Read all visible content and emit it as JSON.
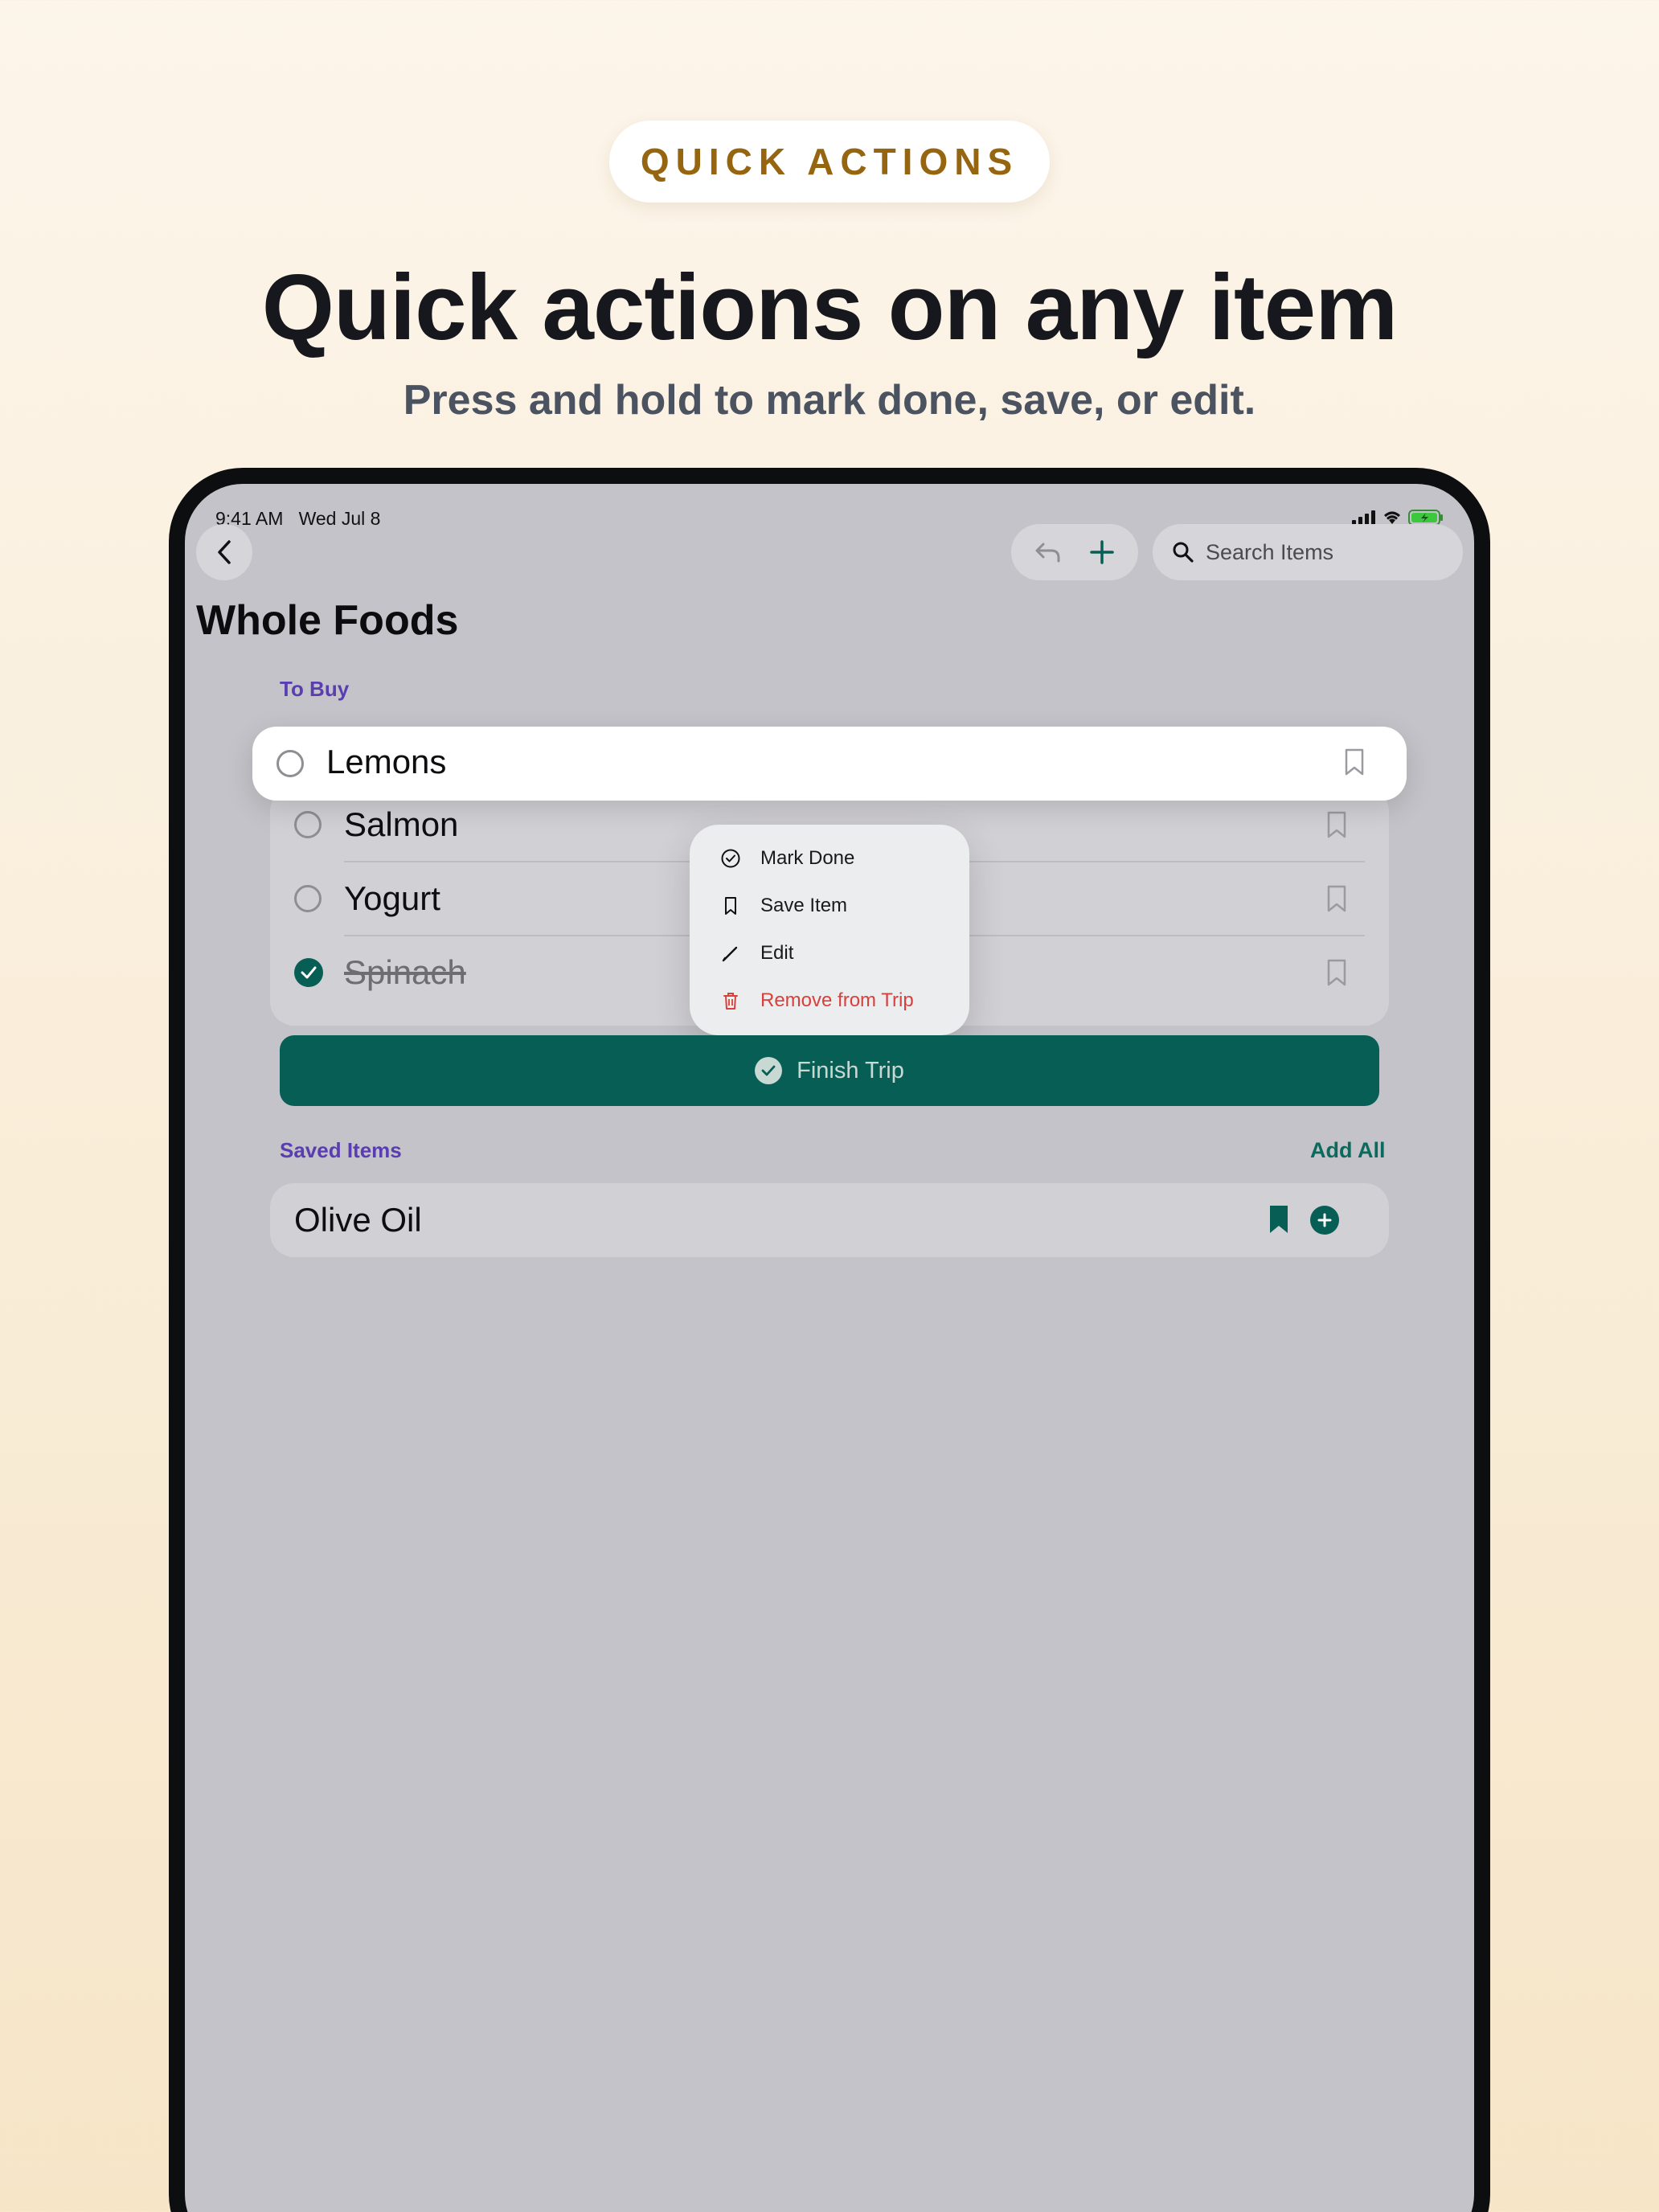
{
  "banner": {
    "pill": "QUICK ACTIONS",
    "headline": "Quick actions on any item",
    "subhead": "Press and hold to mark done, save, or edit."
  },
  "status_bar": {
    "time": "9:41 AM",
    "date": "Wed Jul 8"
  },
  "toolbar": {
    "back_icon": "chevron-left-icon",
    "undo_icon": "undo-icon",
    "add_icon": "plus-icon",
    "search_placeholder": "Search Items"
  },
  "page": {
    "title": "Whole Foods"
  },
  "to_buy": {
    "label": "To Buy",
    "items": [
      {
        "name": "Lemons",
        "done": false,
        "saved": false
      },
      {
        "name": "Salmon",
        "done": false,
        "saved": false
      },
      {
        "name": "Yogurt",
        "done": false,
        "saved": false
      },
      {
        "name": "Spinach",
        "done": true,
        "saved": false
      }
    ]
  },
  "context_menu": {
    "items": [
      {
        "label": "Mark Done",
        "icon": "check-circle-icon"
      },
      {
        "label": "Save Item",
        "icon": "bookmark-icon"
      },
      {
        "label": "Edit",
        "icon": "pencil-icon"
      },
      {
        "label": "Remove from Trip",
        "icon": "trash-icon",
        "destructive": true
      }
    ]
  },
  "finish_button": {
    "label": "Finish Trip"
  },
  "saved_items": {
    "label": "Saved Items",
    "add_all": "Add All",
    "items": [
      {
        "name": "Olive Oil",
        "saved": true
      }
    ]
  },
  "colors": {
    "accent": "#075e55",
    "section_label": "#5a3db0",
    "destructive": "#d8403b",
    "pill_text": "#966510"
  }
}
